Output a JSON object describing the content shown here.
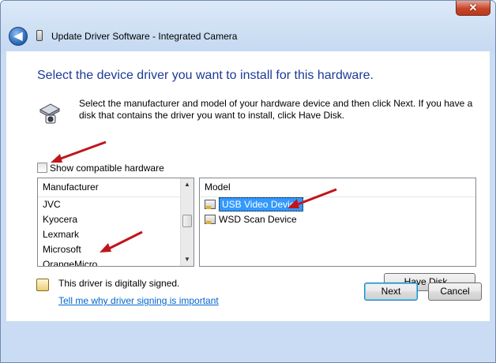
{
  "window": {
    "title": "Update Driver Software - Integrated Camera",
    "close_glyph": "✕",
    "back_glyph": "◀"
  },
  "main": {
    "heading": "Select the device driver you want to install for this hardware.",
    "description": "Select the manufacturer and model of your hardware device and then click Next. If you have a disk that contains the driver you want to install, click Have Disk.",
    "show_compatible_label": "Show compatible hardware",
    "show_compatible_checked": false
  },
  "manufacturer_list": {
    "header": "Manufacturer",
    "items": [
      "JVC",
      "Kyocera",
      "Lexmark",
      "Microsoft",
      "OrangeMicro"
    ]
  },
  "model_list": {
    "header": "Model",
    "items": [
      {
        "label": "USB Video Device",
        "selected": true
      },
      {
        "label": "WSD Scan Device",
        "selected": false
      }
    ]
  },
  "signing": {
    "status": "This driver is digitally signed.",
    "link": "Tell me why driver signing is important"
  },
  "buttons": {
    "have_disk": "Have Disk...",
    "next": "Next",
    "cancel": "Cancel"
  },
  "colors": {
    "heading": "#1e3a96",
    "link": "#0066cc",
    "selection": "#3399ff",
    "annotation_arrow": "#c0151b"
  }
}
